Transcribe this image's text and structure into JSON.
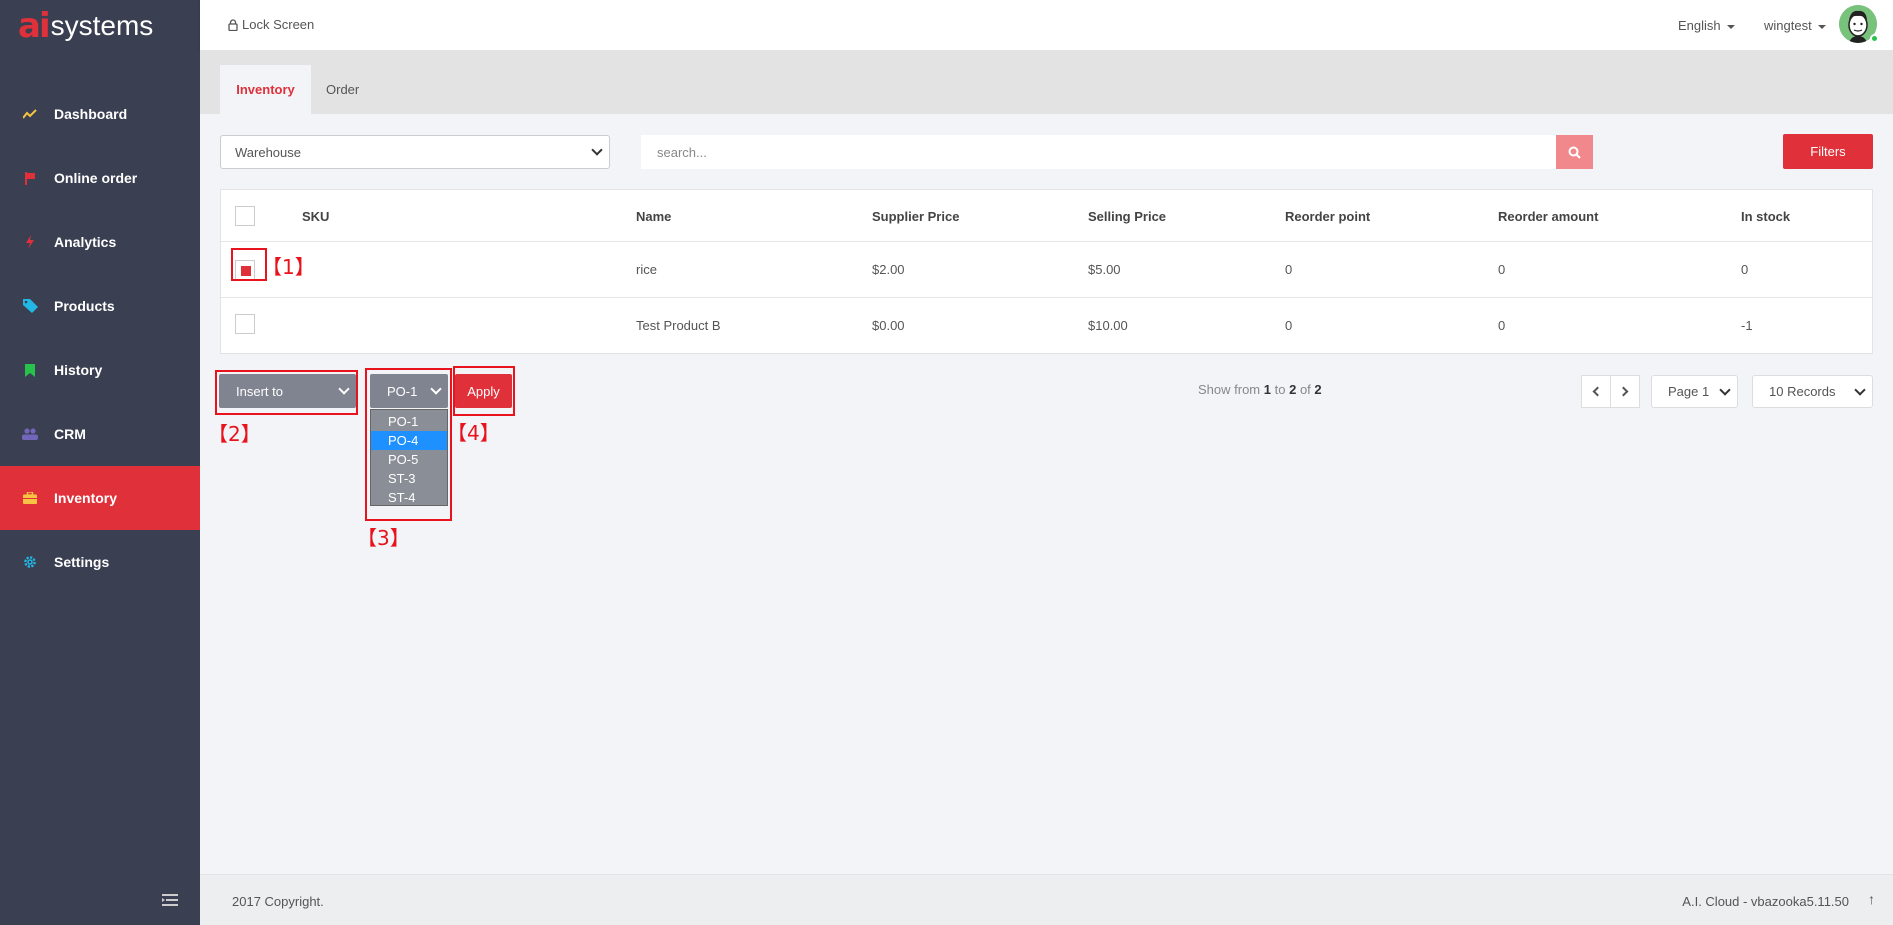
{
  "brand": {
    "mark": "ai",
    "name": "systems"
  },
  "sidebar": {
    "items": [
      {
        "label": "Dashboard",
        "icon": "line-chart-icon",
        "color": "#f6c342"
      },
      {
        "label": "Online order",
        "icon": "flag-icon",
        "color": "#e0303a"
      },
      {
        "label": "Analytics",
        "icon": "bolt-icon",
        "color": "#e0303a"
      },
      {
        "label": "Products",
        "icon": "tags-icon",
        "color": "#23b7e5"
      },
      {
        "label": "History",
        "icon": "bookmark-icon",
        "color": "#27c24c"
      },
      {
        "label": "CRM",
        "icon": "users-icon",
        "color": "#7266ba"
      },
      {
        "label": "Inventory",
        "icon": "briefcase-icon",
        "color": "#f6c342",
        "active": true
      },
      {
        "label": "Settings",
        "icon": "gear-icon",
        "color": "#23b7e5"
      }
    ]
  },
  "header": {
    "lock_label": "Lock Screen",
    "language": "English",
    "username": "wingtest"
  },
  "tabs": [
    {
      "label": "Inventory",
      "active": true
    },
    {
      "label": "Order",
      "active": false
    }
  ],
  "filters": {
    "warehouse_select": "Warehouse",
    "search_placeholder": "search...",
    "filters_button": "Filters"
  },
  "table": {
    "headers": [
      "SKU",
      "Name",
      "Supplier Price",
      "Selling Price",
      "Reorder point",
      "Reorder amount",
      "In stock"
    ],
    "rows": [
      {
        "checked": true,
        "sku": "",
        "name": "rice",
        "supplier_price": "$2.00",
        "selling_price": "$5.00",
        "reorder_point": "0",
        "reorder_amount": "0",
        "in_stock": "0"
      },
      {
        "checked": false,
        "sku": "",
        "name": "Test Product B",
        "supplier_price": "$0.00",
        "selling_price": "$10.00",
        "reorder_point": "0",
        "reorder_amount": "0",
        "in_stock": "-1"
      }
    ]
  },
  "actions": {
    "insert_select": "Insert to",
    "po_select": "PO-1",
    "po_options": [
      "PO-1",
      "PO-4",
      "PO-5",
      "ST-3",
      "ST-4"
    ],
    "po_highlighted": "PO-4",
    "apply_button": "Apply"
  },
  "pagination": {
    "prefix": "Show from",
    "from": "1",
    "to_word": "to",
    "to": "2",
    "of_word": "of",
    "total": "2",
    "page_select": "Page 1",
    "records_select": "10 Records"
  },
  "annotations": [
    "【1】",
    "【2】",
    "【3】",
    "【4】"
  ],
  "footer": {
    "copyright": "2017 Copyright.",
    "version": "A.I. Cloud - vbazooka5.11.50",
    "up_arrow": "↑"
  },
  "colors": {
    "sidebar_bg": "#3a3f51",
    "accent": "#e0303a",
    "annotation": "#e8131c"
  }
}
